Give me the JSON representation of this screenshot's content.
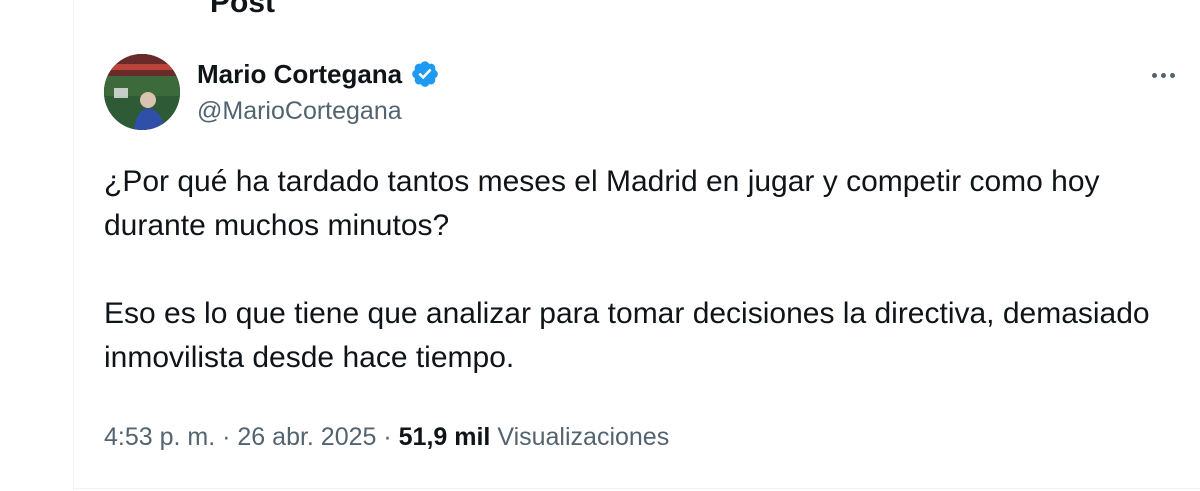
{
  "header": {
    "title": "Post",
    "back_icon": "arrow-left-icon"
  },
  "author": {
    "name": "Mario Cortegana",
    "handle": "@MarioCortegana",
    "verified_icon": "verified-badge-icon",
    "verified_color": "#1d9bf0"
  },
  "more_icon": "more-horizontal-icon",
  "tweet": {
    "paragraph_1": "¿Por qué ha tardado tantos meses el Madrid en jugar y competir como hoy durante muchos minutos?",
    "paragraph_2": "Eso es lo que tiene que analizar para tomar decisiones la directiva, demasiado inmovilista desde hace tiempo."
  },
  "meta": {
    "time": "4:53 p. m.",
    "separator": "·",
    "date": "26 abr. 2025",
    "views_count": "51,9 mil",
    "views_label": "Visualizaciones"
  },
  "colors": {
    "text_primary": "#0f1419",
    "text_secondary": "#536471",
    "divider": "#eff3f4"
  }
}
